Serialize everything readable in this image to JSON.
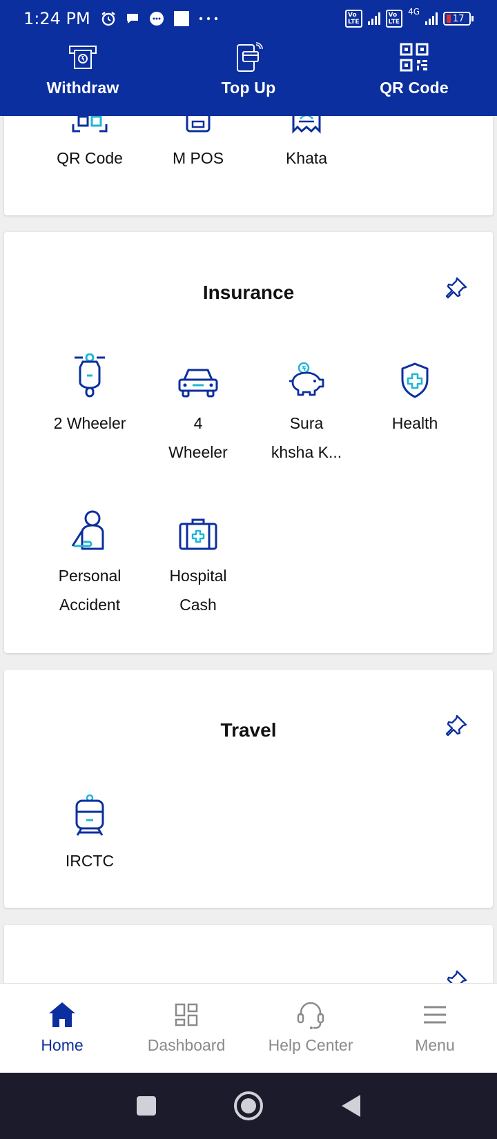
{
  "status_bar": {
    "time": "1:24 PM",
    "network": "4G",
    "battery": "17"
  },
  "quick_actions": [
    {
      "label": "Withdraw",
      "icon": "withdraw-icon"
    },
    {
      "label": "Top Up",
      "icon": "topup-icon"
    },
    {
      "label": "QR Code",
      "icon": "qr-code-icon"
    }
  ],
  "payments_card": {
    "items": [
      {
        "label": "QR Code",
        "icon": "qr-scan-icon"
      },
      {
        "label": "M POS",
        "icon": "mpos-icon"
      },
      {
        "label": "Khata",
        "icon": "khata-icon"
      }
    ]
  },
  "insurance": {
    "title": "Insurance",
    "items": [
      {
        "line1": "2 Wheeler",
        "line2": "",
        "icon": "scooter-icon"
      },
      {
        "line1": "4",
        "line2": "Wheeler",
        "icon": "car-icon"
      },
      {
        "line1": "Sura",
        "line2": "khsha K...",
        "icon": "piggy-bank-icon"
      },
      {
        "line1": "Health",
        "line2": "",
        "icon": "health-shield-icon"
      },
      {
        "line1": "Personal",
        "line2": "Accident",
        "icon": "personal-accident-icon"
      },
      {
        "line1": "Hospital",
        "line2": "Cash",
        "icon": "hospital-kit-icon"
      }
    ]
  },
  "travel": {
    "title": "Travel",
    "items": [
      {
        "label": "IRCTC",
        "icon": "train-icon"
      }
    ]
  },
  "bottom_nav": [
    {
      "label": "Home",
      "icon": "home-icon",
      "active": true
    },
    {
      "label": "Dashboard",
      "icon": "dashboard-icon",
      "active": false
    },
    {
      "label": "Help Center",
      "icon": "headset-icon",
      "active": false
    },
    {
      "label": "Menu",
      "icon": "menu-icon",
      "active": false
    }
  ],
  "colors": {
    "brand": "#0b2f9e",
    "accent": "#1fb6d6",
    "inactive": "#8a8a8a"
  }
}
